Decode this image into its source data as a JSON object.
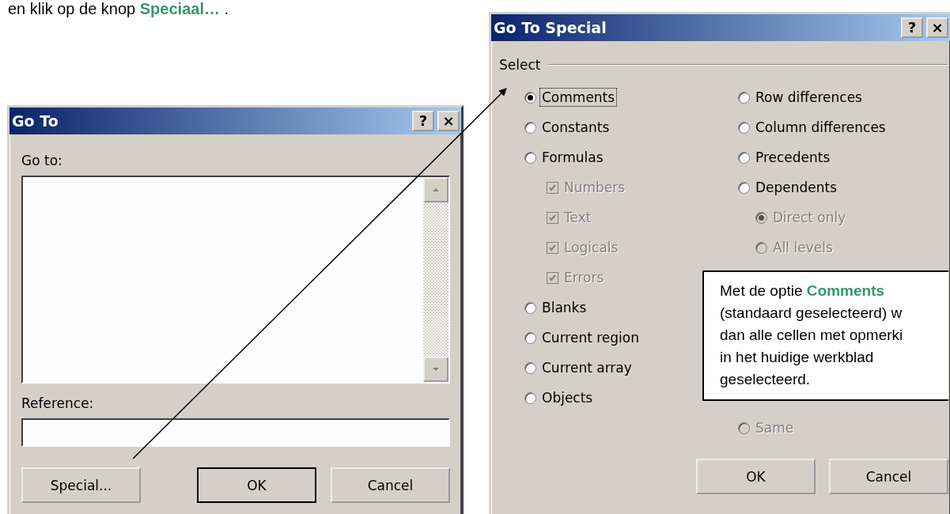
{
  "instruction": "en klik op de knop **Speciaal…** .",
  "goto_dialog": {
    "title": "Go To",
    "help_button": "?",
    "close_button": "×",
    "list_label": "Go to:",
    "reference_label": "Reference:",
    "buttons": [
      {
        "label": "Special...",
        "default": false
      },
      {
        "label": "OK",
        "default": true
      },
      {
        "label": "Cancel",
        "default": false
      }
    ]
  },
  "special_dialog": {
    "title": "Go To Special",
    "help_button": "?",
    "close_button": "×",
    "group_label": "Select",
    "left_options": [
      {
        "kind": "radio",
        "label": "Comments",
        "selected": true,
        "disabled": false,
        "focused": true
      },
      {
        "kind": "radio",
        "label": "Constants",
        "selected": false,
        "disabled": false,
        "focused": false
      },
      {
        "kind": "radio",
        "label": "Formulas",
        "selected": false,
        "disabled": false,
        "focused": false,
        "children": [
          {
            "kind": "checkbox",
            "label": "Numbers",
            "checked": true,
            "disabled": true,
            "focused": false
          },
          {
            "kind": "checkbox",
            "label": "Text",
            "checked": true,
            "disabled": true,
            "focused": false
          },
          {
            "kind": "checkbox",
            "label": "Logicals",
            "checked": true,
            "disabled": true,
            "focused": false
          },
          {
            "kind": "checkbox",
            "label": "Errors",
            "checked": true,
            "disabled": true,
            "focused": false
          }
        ]
      },
      {
        "kind": "radio",
        "label": "Blanks",
        "selected": false,
        "disabled": false,
        "focused": false
      },
      {
        "kind": "radio",
        "label": "Current region",
        "selected": false,
        "disabled": false,
        "focused": false
      },
      {
        "kind": "radio",
        "label": "Current array",
        "selected": false,
        "disabled": false,
        "focused": false
      },
      {
        "kind": "radio",
        "label": "Objects",
        "selected": false,
        "disabled": false,
        "focused": false
      }
    ],
    "right_options": [
      {
        "kind": "radio",
        "label": "Row differences",
        "selected": false,
        "disabled": false,
        "focused": false
      },
      {
        "kind": "radio",
        "label": "Column differences",
        "selected": false,
        "disabled": false,
        "focused": false
      },
      {
        "kind": "radio",
        "label": "Precedents",
        "selected": false,
        "disabled": false,
        "focused": false
      },
      {
        "kind": "radio",
        "label": "Dependents",
        "selected": false,
        "disabled": false,
        "focused": false,
        "children": [
          {
            "kind": "radio",
            "label": "Direct only",
            "selected": true,
            "disabled": true,
            "focused": false
          },
          {
            "kind": "radio",
            "label": "All levels",
            "selected": false,
            "disabled": true,
            "focused": false
          }
        ]
      }
    ],
    "right_lower_options": [
      {
        "kind": "radio",
        "label": "Same",
        "selected": false,
        "disabled": true,
        "focused": false
      }
    ],
    "buttons": [
      {
        "label": "OK",
        "default": false
      },
      {
        "label": "Cancel",
        "default": false
      }
    ]
  },
  "callout": {
    "lines": [
      "Met de optie  **Comments**",
      "(standaard geselecteerd) w",
      "dan alle cellen met opmerki",
      "in het huidige werkblad",
      "geselecteerd."
    ]
  }
}
